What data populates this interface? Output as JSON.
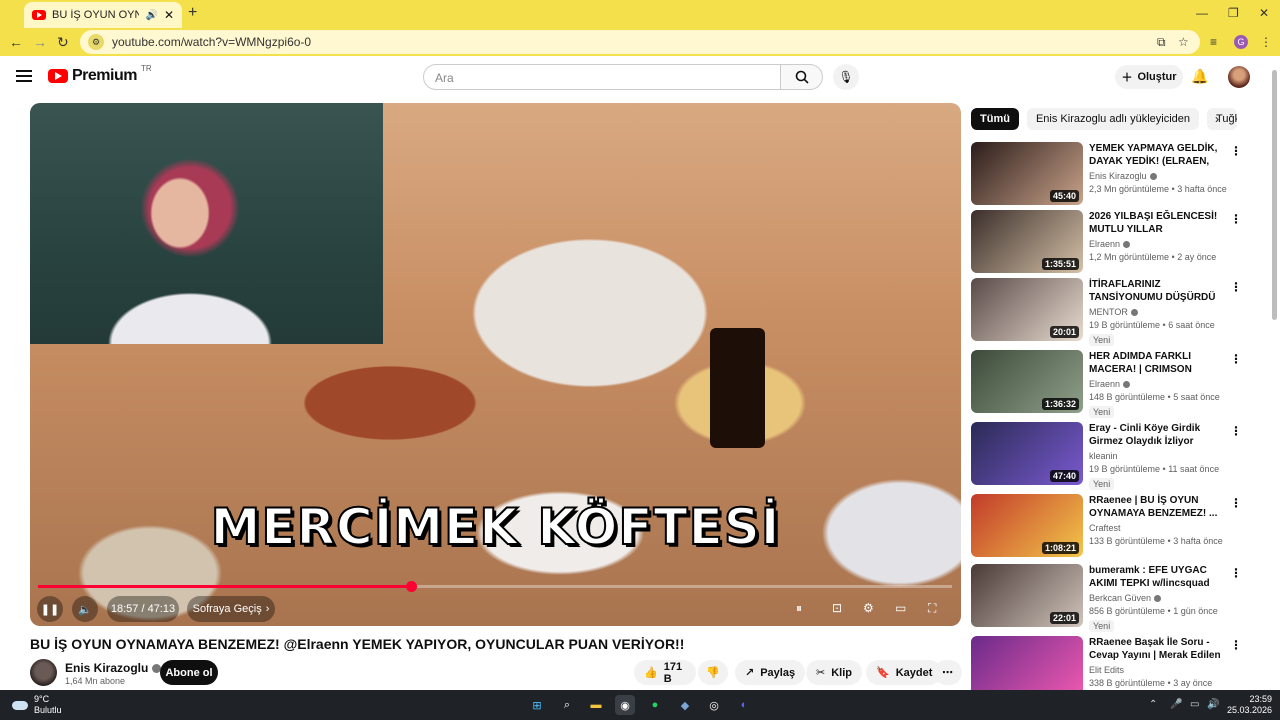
{
  "browser": {
    "tab_title": "BU İŞ OYUN OYNAMAYA BENZEMEZ!",
    "url": "youtube.com/watch?v=WMNgzpi6o-0",
    "new_tab": "+",
    "profile_initial": "G"
  },
  "header": {
    "brand": "Premium",
    "region": "TR",
    "search_placeholder": "Ara",
    "create_label": "Oluştur"
  },
  "player": {
    "caption": "MERCİMEK KÖFTESİ",
    "time": "18:57 / 47:13",
    "next_label": "Sofraya Geçiş",
    "progress": 0.408,
    "accent_color": "#ff0033"
  },
  "video": {
    "title": "BU İŞ OYUN OYNAMAYA BENZEMEZ! @Elraenn YEMEK YAPIYOR, OYUNCULAR PUAN VERİYOR!!",
    "channel": "Enis Kirazoglu",
    "subscribers": "1,64 Mn abone",
    "subscribe_label": "Abone ol",
    "likes": "171 B",
    "share_label": "Paylaş",
    "clip_label": "Klip",
    "save_label": "Kaydet"
  },
  "sidebar": {
    "chips": [
      "Tümü",
      "Enis Kirazoglu adlı yükleyiciden",
      "Tuğka"
    ],
    "items": [
      {
        "title": "YEMEK YAPMAYA GELDİK, DAYAK YEDİK! (ELRAEN, ERAY,...",
        "channel": "Enis Kirazoglu",
        "verified": true,
        "meta": "2,3 Mn görüntüleme • 3 hafta önce",
        "duration": "45:40",
        "new": "",
        "thumb": [
          "#2b1c1a",
          "#c9a38a"
        ]
      },
      {
        "title": "2026 YILBAŞI EĞLENCESİ! MUTLU YILLAR",
        "channel": "Elraenn",
        "verified": true,
        "meta": "1,2 Mn görüntüleme • 2 ay önce",
        "duration": "1:35:51",
        "new": "",
        "thumb": [
          "#3a2e2a",
          "#d6c1a8"
        ]
      },
      {
        "title": "İTİRAFLARINIZ TANSİYONUMU DÜŞÜRDÜ",
        "channel": "MENTOR",
        "verified": true,
        "meta": "19 B görüntüleme • 6 saat önce",
        "duration": "20:01",
        "new": "Yeni",
        "thumb": [
          "#5a4a48",
          "#e8dcd0"
        ]
      },
      {
        "title": "HER ADIMDA FARKLI MACERA! | CRIMSON DESERT |",
        "channel": "Elraenn",
        "verified": true,
        "meta": "148 B görüntüleme • 5 saat önce",
        "duration": "1:36:32",
        "new": "Yeni",
        "thumb": [
          "#3d4a3a",
          "#8fa08a"
        ]
      },
      {
        "title": "Eray - Cinli Köye Girdik Girmez Olaydık İzliyor (Mevtcan Bahav)",
        "channel": "kleanin",
        "verified": false,
        "meta": "19 B görüntüleme • 11 saat önce",
        "duration": "47:40",
        "new": "Yeni",
        "thumb": [
          "#2a2a55",
          "#7a5ad0"
        ]
      },
      {
        "title": "RRaenee | BU İŞ OYUN OYNAMAYA BENZEMEZ! ...",
        "channel": "Craftest",
        "verified": false,
        "meta": "133 B görüntüleme • 3 hafta önce",
        "duration": "1:08:21",
        "new": "",
        "thumb": [
          "#c23a2a",
          "#f3c64a"
        ]
      },
      {
        "title": "bumeramk : EFE UYGAC AKIMI TEPKI w/lincsquad",
        "channel": "Berkcan Güven",
        "verified": true,
        "meta": "856 B görüntüleme • 1 gün önce",
        "duration": "22:01",
        "new": "Yeni",
        "thumb": [
          "#4a3a36",
          "#d0c4bc"
        ]
      },
      {
        "title": "RRaenee Başak İle Soru - Cevap Yayını | Merak Edilen Tüm ...",
        "channel": "Elit Edits",
        "verified": false,
        "meta": "338 B görüntüleme • 3 ay önce",
        "duration": "",
        "new": "",
        "thumb": [
          "#6a2a8a",
          "#f05ab0"
        ]
      }
    ]
  },
  "taskbar": {
    "temp": "9°C",
    "weather": "Bulutlu",
    "time": "23:59",
    "date": "25.03.2026"
  }
}
